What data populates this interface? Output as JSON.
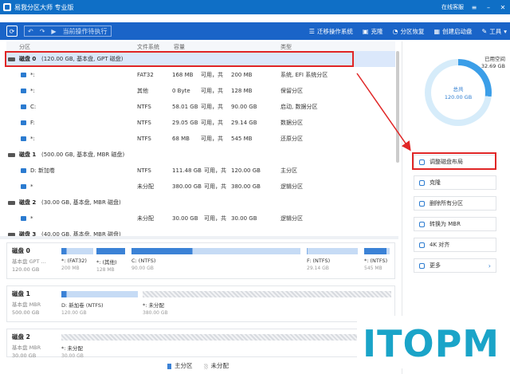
{
  "app": {
    "title": "易我分区大师 专业版",
    "online_service": "在线客服"
  },
  "toolbar": {
    "pending_label": "当前操作待执行",
    "actions": [
      {
        "label": "迁移操作系统",
        "icon": "migrate-os-icon"
      },
      {
        "label": "克隆",
        "icon": "clone-icon"
      },
      {
        "label": "分区恢复",
        "icon": "partition-recovery-icon"
      },
      {
        "label": "创建启动盘",
        "icon": "bootable-media-icon"
      },
      {
        "label": "工具",
        "icon": "tools-icon"
      }
    ]
  },
  "columns": {
    "partition": "分区",
    "filesystem": "文件系统",
    "capacity": "容量",
    "type": "类型"
  },
  "tree": {
    "disk0": {
      "name": "磁盘 0",
      "info": "(120.00 GB, 基本盘, GPT 磁盘)"
    },
    "disk0_parts": [
      {
        "name": "*:",
        "fs": "FAT32",
        "cap": "168 MB",
        "avail": "可用，共",
        "total": "200 MB",
        "type": "系统, EFI 系统分区"
      },
      {
        "name": "*:",
        "fs": "其他",
        "cap": "0 Byte",
        "avail": "可用，共",
        "total": "128 MB",
        "type": "保留分区"
      },
      {
        "name": "C:",
        "fs": "NTFS",
        "cap": "58.01 GB",
        "avail": "可用，共",
        "total": "90.00 GB",
        "type": "启动, 数据分区"
      },
      {
        "name": "F:",
        "fs": "NTFS",
        "cap": "29.05 GB",
        "avail": "可用，共",
        "total": "29.14 GB",
        "type": "数据分区"
      },
      {
        "name": "*:",
        "fs": "NTFS",
        "cap": "68 MB",
        "avail": "可用，共",
        "total": "545 MB",
        "type": "还原分区"
      }
    ],
    "disk1": {
      "name": "磁盘 1",
      "info": "(500.00 GB, 基本盘, MBR 磁盘)"
    },
    "disk1_parts": [
      {
        "name": "D: 新加卷",
        "fs": "NTFS",
        "cap": "111.48 GB",
        "avail": "可用，共",
        "total": "120.00 GB",
        "type": "主分区"
      },
      {
        "name": "*",
        "fs": "未分配",
        "cap": "380.00 GB",
        "avail": "可用，共",
        "total": "380.00 GB",
        "type": "逻辑分区"
      }
    ],
    "disk2": {
      "name": "磁盘 2",
      "info": "(30.00 GB, 基本盘, MBR 磁盘)"
    },
    "disk2_parts": [
      {
        "name": "*",
        "fs": "未分配",
        "cap": "30.00 GB",
        "avail": "可用，共",
        "total": "30.00 GB",
        "type": "逻辑分区"
      }
    ],
    "disk3": {
      "name": "磁盘 3",
      "info": "(40.00 GB, 基本盘, MBR 磁盘)"
    }
  },
  "maps": [
    {
      "title": "磁盘 0",
      "sub1": "基本盘 GPT ...",
      "sub2": "120.00 GB",
      "segments": [
        {
          "l1": "*: (FAT32)",
          "l2": "200 MB",
          "kind": "full",
          "fill": 0.16
        },
        {
          "l1": "*: (其他)",
          "l2": "128 MB",
          "kind": "full",
          "fill": 1.0
        },
        {
          "l1": "C: (NTFS)",
          "l2": "90.00 GB",
          "kind": "part",
          "fill": 0.36
        },
        {
          "l1": "F: (NTFS)",
          "l2": "29.14 GB",
          "kind": "part",
          "fill": 0.01
        },
        {
          "l1": "*: (NTFS)",
          "l2": "545 MB",
          "kind": "full",
          "fill": 0.88
        }
      ]
    },
    {
      "title": "磁盘 1",
      "sub1": "基本盘 MBR",
      "sub2": "500.00 GB",
      "segments": [
        {
          "l1": "D: 新加卷 (NTFS)",
          "l2": "120.00 GB",
          "kind": "part",
          "fill": 0.07
        },
        {
          "l1": "*: 未分配",
          "l2": "380.00 GB",
          "kind": "unalloc",
          "fill": 0
        }
      ]
    },
    {
      "title": "磁盘 2",
      "sub1": "基本盘 MBR",
      "sub2": "30.00 GB",
      "segments": [
        {
          "l1": "*: 未分配",
          "l2": "30.00 GB",
          "kind": "unalloc",
          "fill": 0
        }
      ]
    }
  ],
  "legend": {
    "primary": "主分区",
    "unallocated": "未分配"
  },
  "right": {
    "used_label": "已用空间",
    "used_value": "32.69 GB",
    "total_label": "总共",
    "total_value": "120.00 GB",
    "used_fraction": 0.27,
    "actions": [
      {
        "label": "调整磁盘布局",
        "icon": "layout-icon"
      },
      {
        "label": "克隆",
        "icon": "clone-icon"
      },
      {
        "label": "删除所有分区",
        "icon": "delete-icon"
      },
      {
        "label": "转换为 MBR",
        "icon": "convert-icon"
      },
      {
        "label": "4K 对齐",
        "icon": "align-icon"
      },
      {
        "label": "更多",
        "icon": "more-icon"
      }
    ]
  },
  "watermark": "ITOPM",
  "colors": {
    "brand": "#0f6fc6",
    "primary": "#3b82d6",
    "highlight": "#e02626",
    "watermark": "#1aa4c8"
  }
}
